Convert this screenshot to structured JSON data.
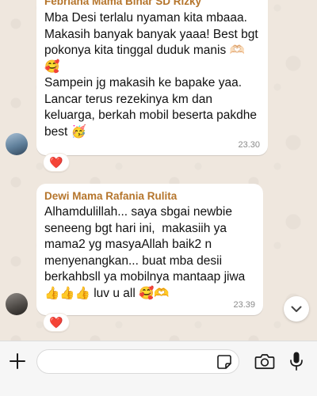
{
  "messages": [
    {
      "sender": "Febriana Mama Binar SD Rizky",
      "text": "Mba Desi terlalu nyaman kita mbaaa. Makasih banyak banyak yaaa! Best bgt pokonya kita tinggal duduk manis 🫶🏻🥰\nSampein jg makasih ke bapake yaa. Lancar terus rezekinya km dan keluarga, berkah mobil beserta pakdhe best 🥳",
      "time": "23.30",
      "reaction": "❤️"
    },
    {
      "sender": "Dewi Mama Rafania Rulita",
      "text": "Alhamdulillah... saya sbgai newbie seneeng bgt hari ini,  makasiih ya mama2 yg masyaAllah baik2 n menyenangkan... buat mba desii berkahbsll ya mobilnya mantaap jiwa👍👍👍 luv u all 🥰🫶",
      "time": "23.39",
      "reaction": "❤️"
    }
  ],
  "composer": {
    "placeholder": ""
  },
  "icons": {
    "plus": "plus-icon",
    "sticker": "sticker-icon",
    "camera": "camera-icon",
    "mic": "microphone-icon",
    "scroll_down": "chevron-down-icon"
  },
  "colors": {
    "wallpaper": "#efe7de",
    "bubble": "#ffffff",
    "sender_name": "#b5752c",
    "timestamp": "#8a8a8a",
    "reaction_heart": "#e0243a"
  }
}
